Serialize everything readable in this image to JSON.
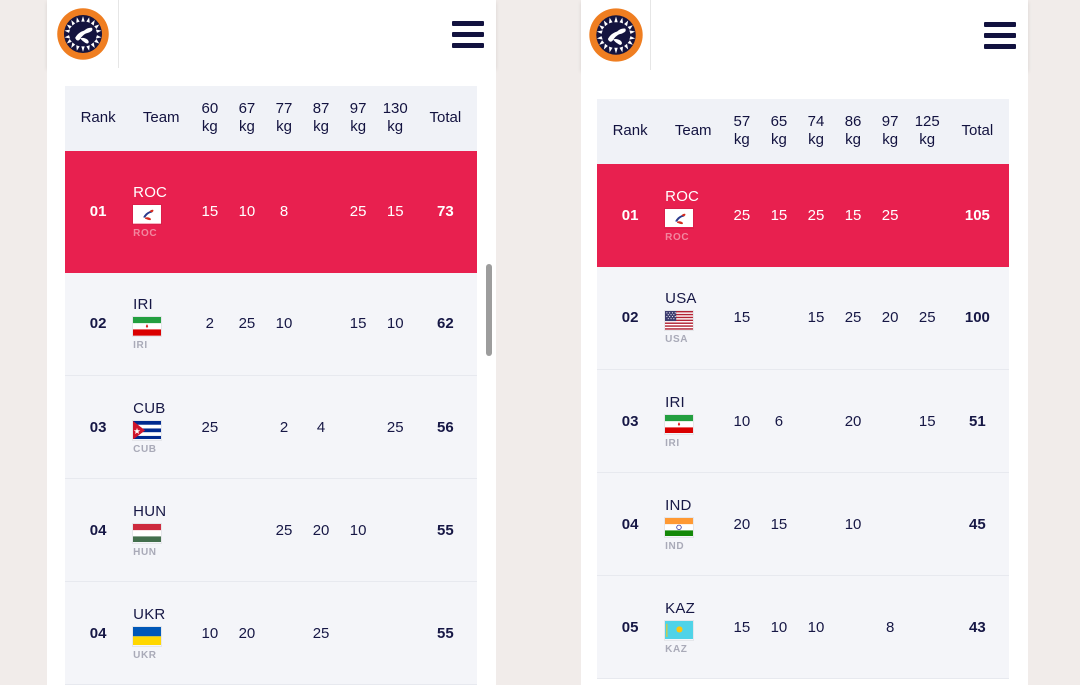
{
  "page": {
    "background_color": "#f1ecea",
    "accent_color": "#e8204f",
    "text_color": "#161745",
    "header_bg": "#f0f2f7",
    "row_bg": "#f4f5f9"
  },
  "panels": [
    {
      "id": "left",
      "appbar": {
        "logo_alt": "uww-logo",
        "menu_label": "menu"
      },
      "table": {
        "columns": [
          "Rank",
          "Team",
          "60 kg",
          "67 kg",
          "77 kg",
          "87 kg",
          "97 kg",
          "130 kg",
          "Total"
        ],
        "weight_classes": [
          {
            "num": "60",
            "unit": "kg"
          },
          {
            "num": "67",
            "unit": "kg"
          },
          {
            "num": "77",
            "unit": "kg"
          },
          {
            "num": "87",
            "unit": "kg"
          },
          {
            "num": "97",
            "unit": "kg"
          },
          {
            "num": "130",
            "unit": "kg"
          }
        ],
        "rank_header": "Rank",
        "team_header": "Team",
        "total_header": "Total",
        "rows": [
          {
            "rank": "01",
            "team": "ROC",
            "team_sub": "ROC",
            "flag": "roc",
            "scores": [
              "15",
              "10",
              "8",
              "",
              "25",
              "15"
            ],
            "total": "73",
            "highlight": true
          },
          {
            "rank": "02",
            "team": "IRI",
            "team_sub": "IRI",
            "flag": "iri",
            "scores": [
              "2",
              "25",
              "10",
              "",
              "15",
              "10"
            ],
            "total": "62",
            "highlight": false
          },
          {
            "rank": "03",
            "team": "CUB",
            "team_sub": "CUB",
            "flag": "cub",
            "scores": [
              "25",
              "",
              "2",
              "4",
              "",
              "25"
            ],
            "total": "56",
            "highlight": false
          },
          {
            "rank": "04",
            "team": "HUN",
            "team_sub": "HUN",
            "flag": "hun",
            "scores": [
              "",
              "",
              "25",
              "20",
              "10",
              ""
            ],
            "total": "55",
            "highlight": false
          },
          {
            "rank": "04",
            "team": "UKR",
            "team_sub": "UKR",
            "flag": "ukr",
            "scores": [
              "10",
              "20",
              "",
              "25",
              "",
              ""
            ],
            "total": "55",
            "highlight": false
          }
        ]
      },
      "scrollbar": {
        "visible": true
      }
    },
    {
      "id": "right",
      "appbar": {
        "logo_alt": "uww-logo",
        "menu_label": "menu"
      },
      "table": {
        "columns": [
          "Rank",
          "Team",
          "57 kg",
          "65 kg",
          "74 kg",
          "86 kg",
          "97 kg",
          "125 kg",
          "Total"
        ],
        "weight_classes": [
          {
            "num": "57",
            "unit": "kg"
          },
          {
            "num": "65",
            "unit": "kg"
          },
          {
            "num": "74",
            "unit": "kg"
          },
          {
            "num": "86",
            "unit": "kg"
          },
          {
            "num": "97",
            "unit": "kg"
          },
          {
            "num": "125",
            "unit": "kg"
          }
        ],
        "rank_header": "Rank",
        "team_header": "Team",
        "total_header": "Total",
        "rows": [
          {
            "rank": "01",
            "team": "ROC",
            "team_sub": "ROC",
            "flag": "roc",
            "scores": [
              "25",
              "15",
              "25",
              "15",
              "25",
              ""
            ],
            "total": "105",
            "highlight": true
          },
          {
            "rank": "02",
            "team": "USA",
            "team_sub": "USA",
            "flag": "usa",
            "scores": [
              "15",
              "",
              "15",
              "25",
              "20",
              "25"
            ],
            "total": "100",
            "highlight": false
          },
          {
            "rank": "03",
            "team": "IRI",
            "team_sub": "IRI",
            "flag": "iri",
            "scores": [
              "10",
              "6",
              "",
              "20",
              "",
              "15"
            ],
            "total": "51",
            "highlight": false
          },
          {
            "rank": "04",
            "team": "IND",
            "team_sub": "IND",
            "flag": "ind",
            "scores": [
              "20",
              "15",
              "",
              "10",
              "",
              ""
            ],
            "total": "45",
            "highlight": false
          },
          {
            "rank": "05",
            "team": "KAZ",
            "team_sub": "KAZ",
            "flag": "kaz",
            "scores": [
              "15",
              "10",
              "10",
              "",
              "8",
              ""
            ],
            "total": "43",
            "highlight": false
          }
        ]
      },
      "scrollbar": {
        "visible": false
      }
    }
  ]
}
